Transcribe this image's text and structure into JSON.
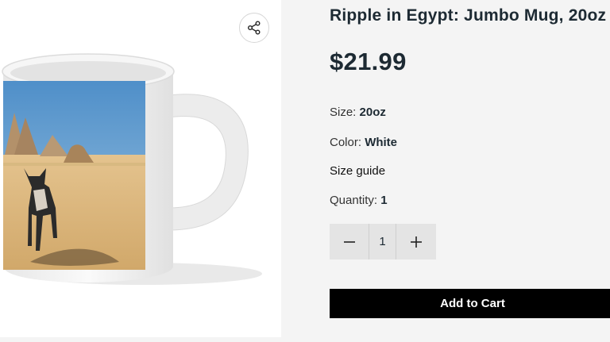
{
  "product": {
    "title": "Ripple in Egypt: Jumbo Mug, 20oz",
    "price": "$21.99",
    "size_label": "Size:",
    "size_value": "20oz",
    "color_label": "Color:",
    "color_value": "White",
    "size_guide_label": "Size guide",
    "quantity_label": "Quantity:",
    "quantity_value": "1"
  },
  "stepper": {
    "value": "1",
    "decrement_icon": "minus-icon",
    "increment_icon": "plus-icon"
  },
  "actions": {
    "add_to_cart_label": "Add to Cart",
    "share_icon": "share-icon"
  },
  "colors": {
    "background": "#f4f4f4",
    "text": "#1d2a33",
    "button": "#000000",
    "stepper_bg": "#e4e4e4"
  }
}
